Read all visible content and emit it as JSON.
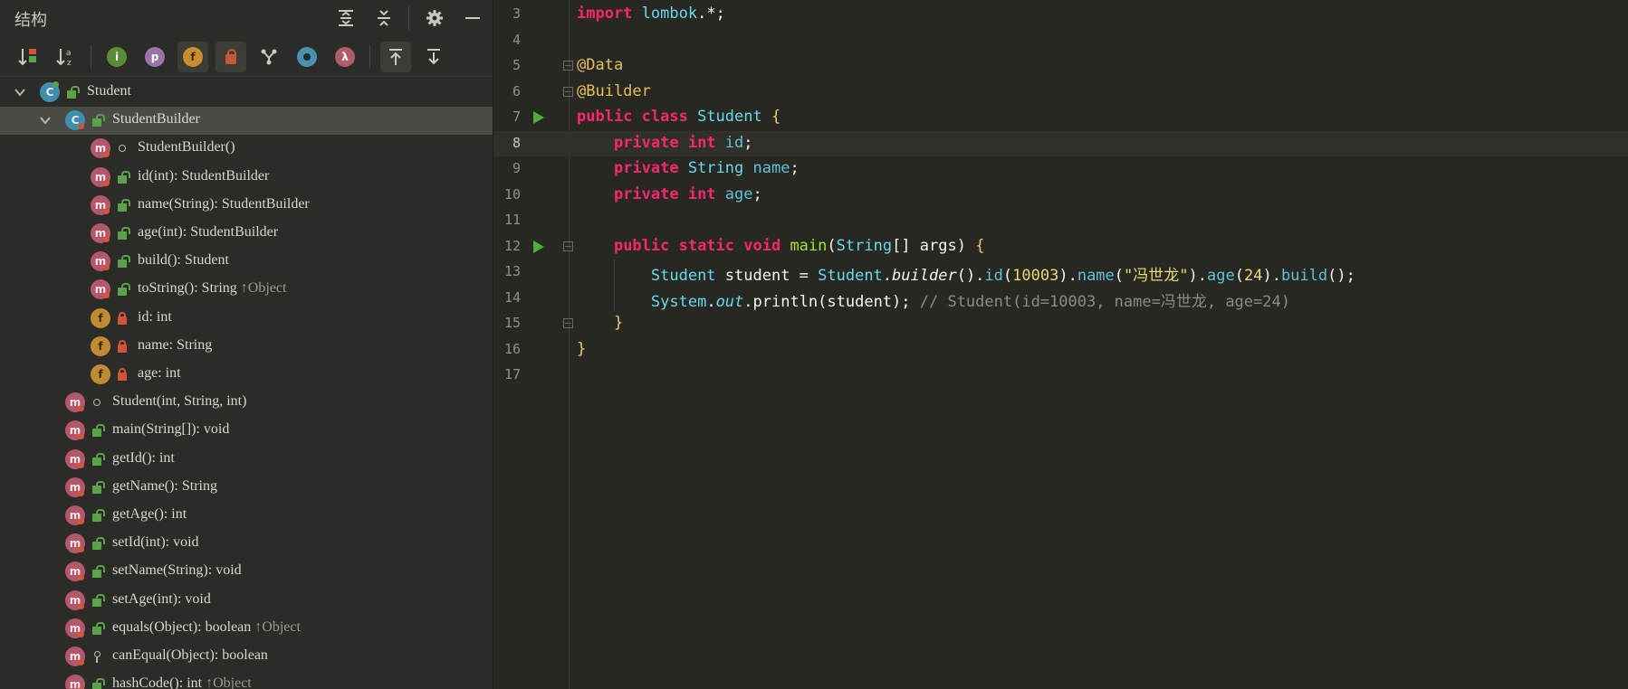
{
  "panel": {
    "title": "结构",
    "tree": [
      {
        "label": "Student",
        "icon": "class-icon",
        "mod": "public",
        "depth": 0,
        "chevron": "expanded"
      },
      {
        "label": "StudentBuilder",
        "icon": "class-icon",
        "mod": "public",
        "depth": 1,
        "chevron": "expanded",
        "selected": true
      },
      {
        "label": "StudentBuilder()",
        "icon": "method-icon",
        "mod": "package",
        "depth": 2
      },
      {
        "label": "id(int): StudentBuilder",
        "icon": "method-icon",
        "mod": "public",
        "depth": 2
      },
      {
        "label": "name(String): StudentBuilder",
        "icon": "method-icon",
        "mod": "public",
        "depth": 2
      },
      {
        "label": "age(int): StudentBuilder",
        "icon": "method-icon",
        "mod": "public",
        "depth": 2
      },
      {
        "label": "build(): Student",
        "icon": "method-icon",
        "mod": "public",
        "depth": 2
      },
      {
        "label": "toString(): String",
        "suffix": "↑Object",
        "icon": "method-icon",
        "mod": "public",
        "depth": 2
      },
      {
        "label": "id: int",
        "icon": "field-icon",
        "mod": "private",
        "depth": 2
      },
      {
        "label": "name: String",
        "icon": "field-icon",
        "mod": "private",
        "depth": 2
      },
      {
        "label": "age: int",
        "icon": "field-icon",
        "mod": "private",
        "depth": 2
      },
      {
        "label": "Student(int, String, int)",
        "icon": "method-icon",
        "mod": "package",
        "depth": 1
      },
      {
        "label": "main(String[]): void",
        "icon": "method-icon",
        "mod": "public",
        "depth": 1
      },
      {
        "label": "getId(): int",
        "icon": "method-icon",
        "mod": "public",
        "depth": 1
      },
      {
        "label": "getName(): String",
        "icon": "method-icon",
        "mod": "public",
        "depth": 1
      },
      {
        "label": "getAge(): int",
        "icon": "method-icon",
        "mod": "public",
        "depth": 1
      },
      {
        "label": "setId(int): void",
        "icon": "method-icon",
        "mod": "public",
        "depth": 1
      },
      {
        "label": "setName(String): void",
        "icon": "method-icon",
        "mod": "public",
        "depth": 1
      },
      {
        "label": "setAge(int): void",
        "icon": "method-icon",
        "mod": "public",
        "depth": 1
      },
      {
        "label": "equals(Object): boolean",
        "suffix": "↑Object",
        "icon": "method-icon",
        "mod": "public",
        "depth": 1
      },
      {
        "label": "canEqual(Object): boolean",
        "icon": "method-icon",
        "mod": "protected",
        "depth": 1
      },
      {
        "label": "hashCode(): int",
        "suffix": "↑Object",
        "icon": "method-icon",
        "mod": "public",
        "depth": 1
      }
    ]
  },
  "editor": {
    "current_line": "8",
    "lines": [
      {
        "n": "3",
        "html": "<span class='k'>import</span> <span class='ty'>lombok</span>.*;"
      },
      {
        "n": "4",
        "html": ""
      },
      {
        "n": "5",
        "html": "<span class='an'>@Data</span>"
      },
      {
        "n": "6",
        "html": "<span class='an'>@Builder</span>"
      },
      {
        "n": "7",
        "html": "<span class='k'>public class</span> <span class='ty'>Student</span> <span class='br'>{</span>"
      },
      {
        "n": "8",
        "html": "    <span class='k'>private int</span> <span class='fd'>id</span>;"
      },
      {
        "n": "9",
        "html": "    <span class='k'>private</span> <span class='ty'>String</span> <span class='fd'>name</span>;"
      },
      {
        "n": "10",
        "html": "    <span class='k'>private int</span> <span class='fd'>age</span>;"
      },
      {
        "n": "11",
        "html": ""
      },
      {
        "n": "12",
        "html": "    <span class='k'>public static void</span> <span class='fn'>main</span>(<span class='ty'>String</span>[] args) <span class='br'>{</span>"
      },
      {
        "n": "13",
        "html": "        <span class='ty'>Student</span> student = <span class='ty'>Student</span>.<span class='it'>builder</span>().<span class='fd'>id</span>(<span class='num'>10003</span>).<span class='fd'>name</span>(<span class='st'>\"冯世龙\"</span>).<span class='fd'>age</span>(<span class='num'>24</span>).<span class='fd'>build</span>();"
      },
      {
        "n": "14",
        "html": "        <span class='ty'>System</span>.<span class='it ty'>out</span>.println(student); <span class='cm'>// Student(id=10003, name=冯世龙, age=24)</span>"
      },
      {
        "n": "15",
        "html": "    <span class='br'>}</span>"
      },
      {
        "n": "16",
        "html": "<span class='br'>}</span>"
      },
      {
        "n": "17",
        "html": ""
      }
    ]
  }
}
